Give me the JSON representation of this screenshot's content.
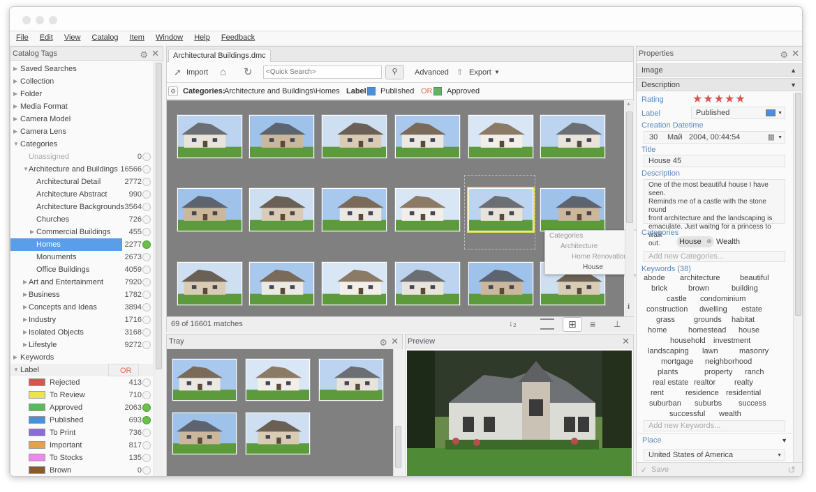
{
  "menu": [
    "File",
    "Edit",
    "View",
    "Catalog",
    "Item",
    "Window",
    "Help",
    "Feedback"
  ],
  "left_panel": {
    "title": "Catalog Tags",
    "items": [
      {
        "label": "Saved Searches",
        "level": 0,
        "twisty": "▶"
      },
      {
        "label": "Collection",
        "level": 0,
        "twisty": "▶"
      },
      {
        "label": "Folder",
        "level": 0,
        "twisty": "▶"
      },
      {
        "label": "Media Format",
        "level": 0,
        "twisty": "▶"
      },
      {
        "label": "Camera Model",
        "level": 0,
        "twisty": "▶"
      },
      {
        "label": "Camera Lens",
        "level": 0,
        "twisty": "▶"
      },
      {
        "label": "Categories",
        "level": 0,
        "twisty": "▼"
      },
      {
        "label": "Unassigned",
        "level": 1,
        "count": "0",
        "muted": true
      },
      {
        "label": "Architecture and Buildings",
        "level": 1,
        "twisty": "▼",
        "count": "16566"
      },
      {
        "label": "Architectural Detail",
        "level": 2,
        "count": "2772"
      },
      {
        "label": "Architecture Abstract",
        "level": 2,
        "count": "990"
      },
      {
        "label": "Architecture Backgrounds",
        "level": 2,
        "count": "3564"
      },
      {
        "label": "Churches",
        "level": 2,
        "count": "726"
      },
      {
        "label": "Commercial Buildings",
        "level": 2,
        "twisty": "▶",
        "count": "455"
      },
      {
        "label": "Homes",
        "level": 2,
        "count": "2277",
        "selected": true,
        "checked": true
      },
      {
        "label": "Monuments",
        "level": 2,
        "count": "2673"
      },
      {
        "label": "Office Buildings",
        "level": 2,
        "count": "4059"
      },
      {
        "label": "Art and Entertainment",
        "level": 1,
        "twisty": "▶",
        "count": "7920"
      },
      {
        "label": "Business",
        "level": 1,
        "twisty": "▶",
        "count": "1782"
      },
      {
        "label": "Concepts and Ideas",
        "level": 1,
        "twisty": "▶",
        "count": "3894"
      },
      {
        "label": "Industry",
        "level": 1,
        "twisty": "▶",
        "count": "1716"
      },
      {
        "label": "Isolated Objects",
        "level": 1,
        "twisty": "▶",
        "count": "3168"
      },
      {
        "label": "Lifestyle",
        "level": 1,
        "twisty": "▶",
        "count": "9272"
      },
      {
        "label": "Keywords",
        "level": 0,
        "twisty": "▶"
      },
      {
        "label": "Label",
        "level": 0,
        "twisty": "▼",
        "or": "OR"
      },
      {
        "label": "Rejected",
        "level": 3,
        "count": "413",
        "swatch": "#d9534f"
      },
      {
        "label": "To Review",
        "level": 3,
        "count": "710",
        "swatch": "#e8e64a"
      },
      {
        "label": "Approved",
        "level": 3,
        "count": "2063",
        "swatch": "#5cb85c",
        "checked": true
      },
      {
        "label": "Published",
        "level": 3,
        "count": "693",
        "swatch": "#4a8fd9",
        "checked": true
      },
      {
        "label": "To Print",
        "level": 3,
        "count": "736",
        "swatch": "#8b6bd9"
      },
      {
        "label": "Important",
        "level": 3,
        "count": "817",
        "swatch": "#e8a050"
      },
      {
        "label": "To Stocks",
        "level": 3,
        "count": "135",
        "swatch": "#ee88ee"
      },
      {
        "label": "Brown",
        "level": 3,
        "count": "0",
        "swatch": "#8b5a2b"
      }
    ]
  },
  "doc_tab": "Architectural Buildings.dmc",
  "toolbar": {
    "import": "Import",
    "search_placeholder": "<Quick Search>",
    "advanced": "Advanced",
    "export": "Export"
  },
  "filter": {
    "categories_label": "Categories:",
    "categories_value": "Architecture and Buildings\\Homes",
    "label_label": "Label:",
    "label1": "Published",
    "or": "OR",
    "label2": "Approved",
    "label1_color": "#4a8fd9",
    "label2_color": "#5cb85c"
  },
  "grid": {
    "status": "69 of 16601 matches",
    "popup": [
      "Categories",
      "Architecture",
      "Home Renovations",
      "House"
    ]
  },
  "tray": {
    "title": "Tray"
  },
  "preview": {
    "title": "Preview"
  },
  "properties": {
    "title": "Properties",
    "image_section": "Image",
    "description_section": "Description",
    "rating_label": "Rating",
    "rating": 5,
    "stars": "★★★★★",
    "label_label": "Label",
    "label_value": "Published",
    "created_label": "Creation Datetime",
    "created_day": "30",
    "created_month": "Май",
    "created_rest": "2004, 00:44:54",
    "title_label": "Title",
    "title_value": "House 45",
    "desc_label": "Description",
    "desc_lines": [
      "One of the most beautiful house I have seen.",
      "Reminds me of a castle with the stone round",
      "front architecture and the landscaping is",
      "emaculate. Just waitng for a princess to walk",
      "out."
    ],
    "categories_label": "Categories",
    "cat1": "House",
    "cat2": "Wealth",
    "add_categories": "Add new Categories...",
    "keywords_label": "Keywords (38)",
    "keywords": [
      "abode",
      "architecture",
      "beautiful",
      "brick",
      "brown",
      "building",
      "castle",
      "condominium",
      "construction",
      "dwelling",
      "estate",
      "grass",
      "grounds",
      "habitat",
      "home",
      "homestead",
      "house",
      "household",
      "investment",
      "landscaping",
      "lawn",
      "masonry",
      "mortgage",
      "neighborhood",
      "plants",
      "property",
      "ranch",
      "real estate",
      "realtor",
      "realty",
      "rent",
      "residence",
      "residential",
      "suburban",
      "suburbs",
      "success",
      "successful",
      "wealth"
    ],
    "add_keywords": "Add new Keywords...",
    "place_label": "Place",
    "place_value": "United States of America",
    "save": "Save"
  }
}
